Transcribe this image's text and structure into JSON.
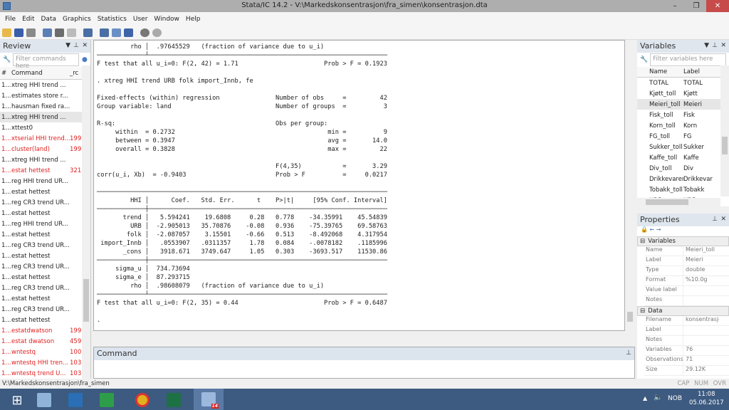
{
  "window": {
    "title": "Stata/IC 14.2 - V:\\Markedskonsentrasjon\\fra_simen\\konsentrasjon.dta",
    "minimize": "–",
    "maximize": "❐",
    "close": "✕"
  },
  "menu": [
    "File",
    "Edit",
    "Data",
    "Graphics",
    "Statistics",
    "User",
    "Window",
    "Help"
  ],
  "toolbar_icons": [
    "open-icon",
    "save-icon",
    "print-icon",
    "log-icon",
    "viewer-icon",
    "graph-icon",
    "do-file-editor-icon",
    "data-editor-icon",
    "data-browser-icon",
    "variables-manager-icon",
    "more-icon",
    "break-icon"
  ],
  "review": {
    "title": "Review",
    "filter_placeholder": "Filter commands here",
    "col_num": "#",
    "col_command": "Command",
    "col_rc": "_rc",
    "rows": [
      {
        "n": "1...",
        "cmd": " xtreg HHI trend ...",
        "rc": "",
        "err": false
      },
      {
        "n": "1...",
        "cmd": "estimates store r...",
        "rc": "",
        "err": false
      },
      {
        "n": "1...",
        "cmd": "hausman fixed ra...",
        "rc": "",
        "err": false
      },
      {
        "n": "1...",
        "cmd": "xtreg HHI trend ...",
        "rc": "",
        "err": false,
        "sel": true
      },
      {
        "n": "1...",
        "cmd": "xttest0",
        "rc": "",
        "err": false
      },
      {
        "n": "1...",
        "cmd": "xtserial HHI trend...",
        "rc": "199",
        "err": true
      },
      {
        "n": "1...",
        "cmd": "cluster(land)",
        "rc": "199",
        "err": true
      },
      {
        "n": "1...",
        "cmd": " xtreg HHI trend ...",
        "rc": "",
        "err": false
      },
      {
        "n": "1...",
        "cmd": "estat hettest",
        "rc": "321",
        "err": true
      },
      {
        "n": "1...",
        "cmd": "reg HHI trend UR...",
        "rc": "",
        "err": false
      },
      {
        "n": "1...",
        "cmd": "estat hettest",
        "rc": "",
        "err": false
      },
      {
        "n": "1...",
        "cmd": "reg CR3 trend UR...",
        "rc": "",
        "err": false
      },
      {
        "n": "1...",
        "cmd": "estat hettest",
        "rc": "",
        "err": false
      },
      {
        "n": "1...",
        "cmd": "reg HHI trend UR...",
        "rc": "",
        "err": false
      },
      {
        "n": "1...",
        "cmd": "estat hettest",
        "rc": "",
        "err": false
      },
      {
        "n": "1...",
        "cmd": "reg CR3 trend UR...",
        "rc": "",
        "err": false
      },
      {
        "n": "1...",
        "cmd": "estat hettest",
        "rc": "",
        "err": false
      },
      {
        "n": "1...",
        "cmd": "reg CR3 trend UR...",
        "rc": "",
        "err": false
      },
      {
        "n": "1...",
        "cmd": "estat hettest",
        "rc": "",
        "err": false
      },
      {
        "n": "1...",
        "cmd": "reg CR3 trend UR...",
        "rc": "",
        "err": false
      },
      {
        "n": "1...",
        "cmd": "estat hettest",
        "rc": "",
        "err": false
      },
      {
        "n": "1...",
        "cmd": "reg CR3 trend UR...",
        "rc": "",
        "err": false
      },
      {
        "n": "1...",
        "cmd": "estat hettest",
        "rc": "",
        "err": false
      },
      {
        "n": "1...",
        "cmd": "estatdwatson",
        "rc": "199",
        "err": true
      },
      {
        "n": "1...",
        "cmd": "estat dwatson",
        "rc": "459",
        "err": true
      },
      {
        "n": "1...",
        "cmd": "wntestq",
        "rc": "100",
        "err": true
      },
      {
        "n": "1...",
        "cmd": "wntestq HHI tren...",
        "rc": "103",
        "err": true
      },
      {
        "n": "1...",
        "cmd": " wntestq trend U...",
        "rc": "103",
        "err": true
      }
    ]
  },
  "results": {
    "lines": [
      "         rho │  .97645529   (fraction of variance due to u_i)",
      "─────────────┴────────────────────────────────────────────────────────────────",
      "F test that all u_i=0: F(2, 42) = 1.71                       Prob > F = 0.1923",
      "",
      ". xtreg HHI trend URB folk import_Innb, fe",
      "",
      "Fixed-effects (within) regression               Number of obs     =         42",
      "Group variable: land                            Number of groups  =          3",
      "",
      "R-sq:                                           Obs per group:",
      "     within  = 0.2732                                         min =          9",
      "     between = 0.3947                                         avg =       14.0",
      "     overall = 0.3828                                         max =         22",
      "",
      "                                                F(4,35)           =       3.29",
      "corr(u_i, Xb)  = -0.9403                        Prob > F          =     0.0217",
      "",
      "──────────────────────────────────────────────────────────────────────────────",
      "         HHI │      Coef.   Std. Err.      t    P>|t|     [95% Conf. Interval]",
      "─────────────┼────────────────────────────────────────────────────────────────",
      "       trend │   5.594241    19.6808     0.28   0.778    -34.35991    45.54839",
      "         URB │  -2.905013   35.70876    -0.08   0.936    -75.39765    69.58763",
      "        folk │  -2.087057    3.15501    -0.66   0.513    -8.492068    4.317954",
      " import_Innb │   .0553907   .0311357     1.78   0.084    -.0078182    .1185996",
      "       _cons │   3918.671   3749.647     1.05   0.303    -3693.517    11530.86",
      "─────────────┼────────────────────────────────────────────────────────────────",
      "     sigma_u │  734.73694",
      "     sigma_e │  87.293715",
      "         rho │  .98608079   (fraction of variance due to u_i)",
      "─────────────┴────────────────────────────────────────────────────────────────",
      "F test that all u_i=0: F(2, 35) = 0.44                       Prob > F = 0.6487",
      "",
      "."
    ]
  },
  "command": {
    "title": "Command"
  },
  "variables": {
    "title": "Variables",
    "filter_placeholder": "Filter variables here",
    "col_name": "Name",
    "col_label": "Label",
    "rows": [
      [
        "TOTAL",
        "TOTAL"
      ],
      [
        "Kjøtt_toll",
        "Kjøtt"
      ],
      [
        "Meieri_toll",
        "Meieri"
      ],
      [
        "Fisk_toll",
        "Fisk"
      ],
      [
        "Korn_toll",
        "Korn"
      ],
      [
        "FG_toll",
        "FG"
      ],
      [
        "Sukker_toll",
        "Sukker"
      ],
      [
        "Kaffe_toll",
        "Kaffe"
      ],
      [
        "Div_toll",
        "Div"
      ],
      [
        "Drikkevarer_t...",
        "Drikkevar"
      ],
      [
        "Tobakk_toll",
        "Tobakk"
      ],
      [
        "URB",
        "URB"
      ]
    ],
    "selected": 2
  },
  "properties": {
    "title": "Properties",
    "sec_vars": "Variables",
    "sec_data": "Data",
    "vars": [
      [
        "Name",
        "Meieri_toll"
      ],
      [
        "Label",
        "Meieri"
      ],
      [
        "Type",
        "double"
      ],
      [
        "Format",
        "%10.0g"
      ],
      [
        "Value label",
        ""
      ],
      [
        "Notes",
        ""
      ]
    ],
    "data": [
      [
        "Filename",
        "konsentrasjon"
      ],
      [
        "Label",
        ""
      ],
      [
        "Notes",
        ""
      ],
      [
        "Variables",
        "76"
      ],
      [
        "Observations",
        "71"
      ],
      [
        "Size",
        "29.12K"
      ]
    ]
  },
  "status": {
    "path": "V:\\Markedskonsentrasjon\\fra_simen",
    "cap": "CAP",
    "num": "NUM",
    "ovr": "OVR"
  },
  "taskbar": {
    "lang": "NOB",
    "time": "11:08",
    "date": "05.06.2017",
    "stata_badge": "14"
  }
}
